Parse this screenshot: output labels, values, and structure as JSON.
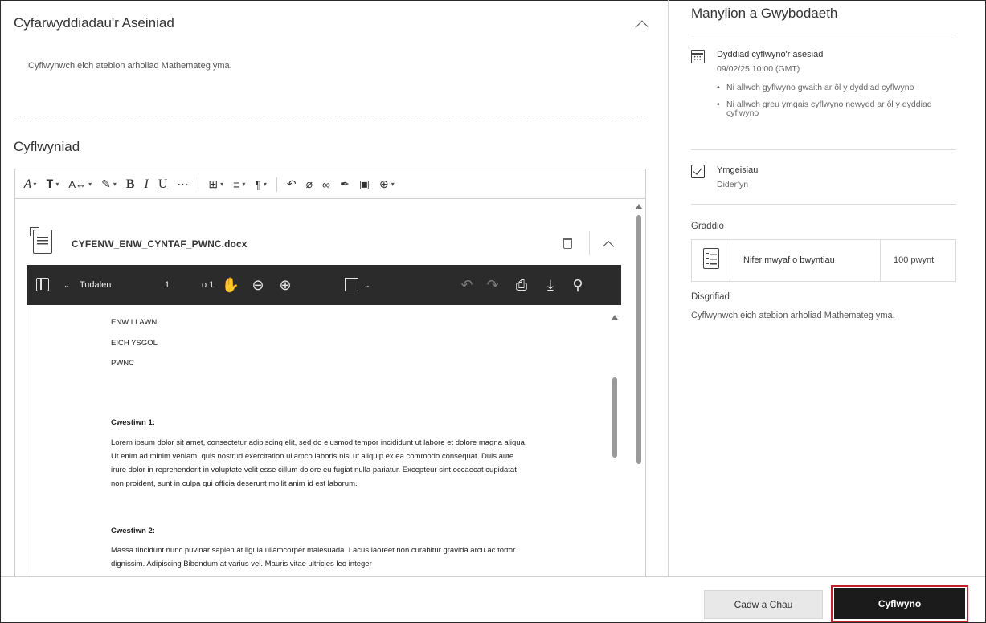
{
  "instructions_section": {
    "title": "Cyfarwyddiadau'r Aseiniad",
    "text": "Cyflwynwch eich atebion arholiad Mathemateg yma."
  },
  "submission_section": {
    "title": "Cyflwyniad"
  },
  "file": {
    "name": "CYFENW_ENW_CYNTAF_PWNC.docx"
  },
  "viewer": {
    "page_label": "Tudalen",
    "page_current": "1",
    "page_total": "o 1"
  },
  "document": {
    "line1": "ENW LLAWN",
    "line2": "EICH YSGOL",
    "line3": "PWNC",
    "q1_heading": "Cwestiwn 1:",
    "q1_text": "Lorem ipsum dolor sit amet, consectetur adipiscing elit, sed do eiusmod tempor incididunt ut labore et dolore magna aliqua. Ut enim ad minim veniam, quis nostrud exercitation ullamco laboris nisi ut aliquip ex ea commodo consequat. Duis aute irure dolor in reprehenderit in voluptate velit esse cillum dolore eu fugiat nulla pariatur. Excepteur sint occaecat cupidatat non proident, sunt in culpa qui officia deserunt mollit anim id est laborum.",
    "q2_heading": "Cwestiwn 2:",
    "q2_text": "Massa tincidunt nunc puvinar sapien at ligula ullamcorper malesuada. Lacus laoreet non curabitur gravida arcu ac tortor dignissim. Adipiscing Bibendum at varius vel. Mauris vitae ultricies leo integer"
  },
  "details": {
    "title": "Manylion a Gwybodaeth",
    "due_label": "Dyddiad cyflwyno'r asesiad",
    "due_value": "09/02/25 10:00 (GMT)",
    "notes": [
      "Ni allwch gyflwyno gwaith ar ôl y dyddiad cyflwyno",
      "Ni allwch greu ymgais cyflwyno newydd ar ôl y dyddiad cyflwyno"
    ],
    "attempts_label": "Ymgeisiau",
    "attempts_value": "Diderfyn",
    "grading_label": "Graddio",
    "max_points_label": "Nifer mwyaf o bwyntiau",
    "max_points_value": "100 pwynt",
    "description_label": "Disgrifiad",
    "description_text": "Cyflwynwch eich atebion arholiad Mathemateg yma."
  },
  "footer": {
    "save_label": "Cadw a Chau",
    "submit_label": "Cyflwyno"
  },
  "colors": {
    "submit_bg": "#1b1b1b",
    "submit_highlight": "#c4212e",
    "viewer_bar": "#2b2b2b"
  }
}
